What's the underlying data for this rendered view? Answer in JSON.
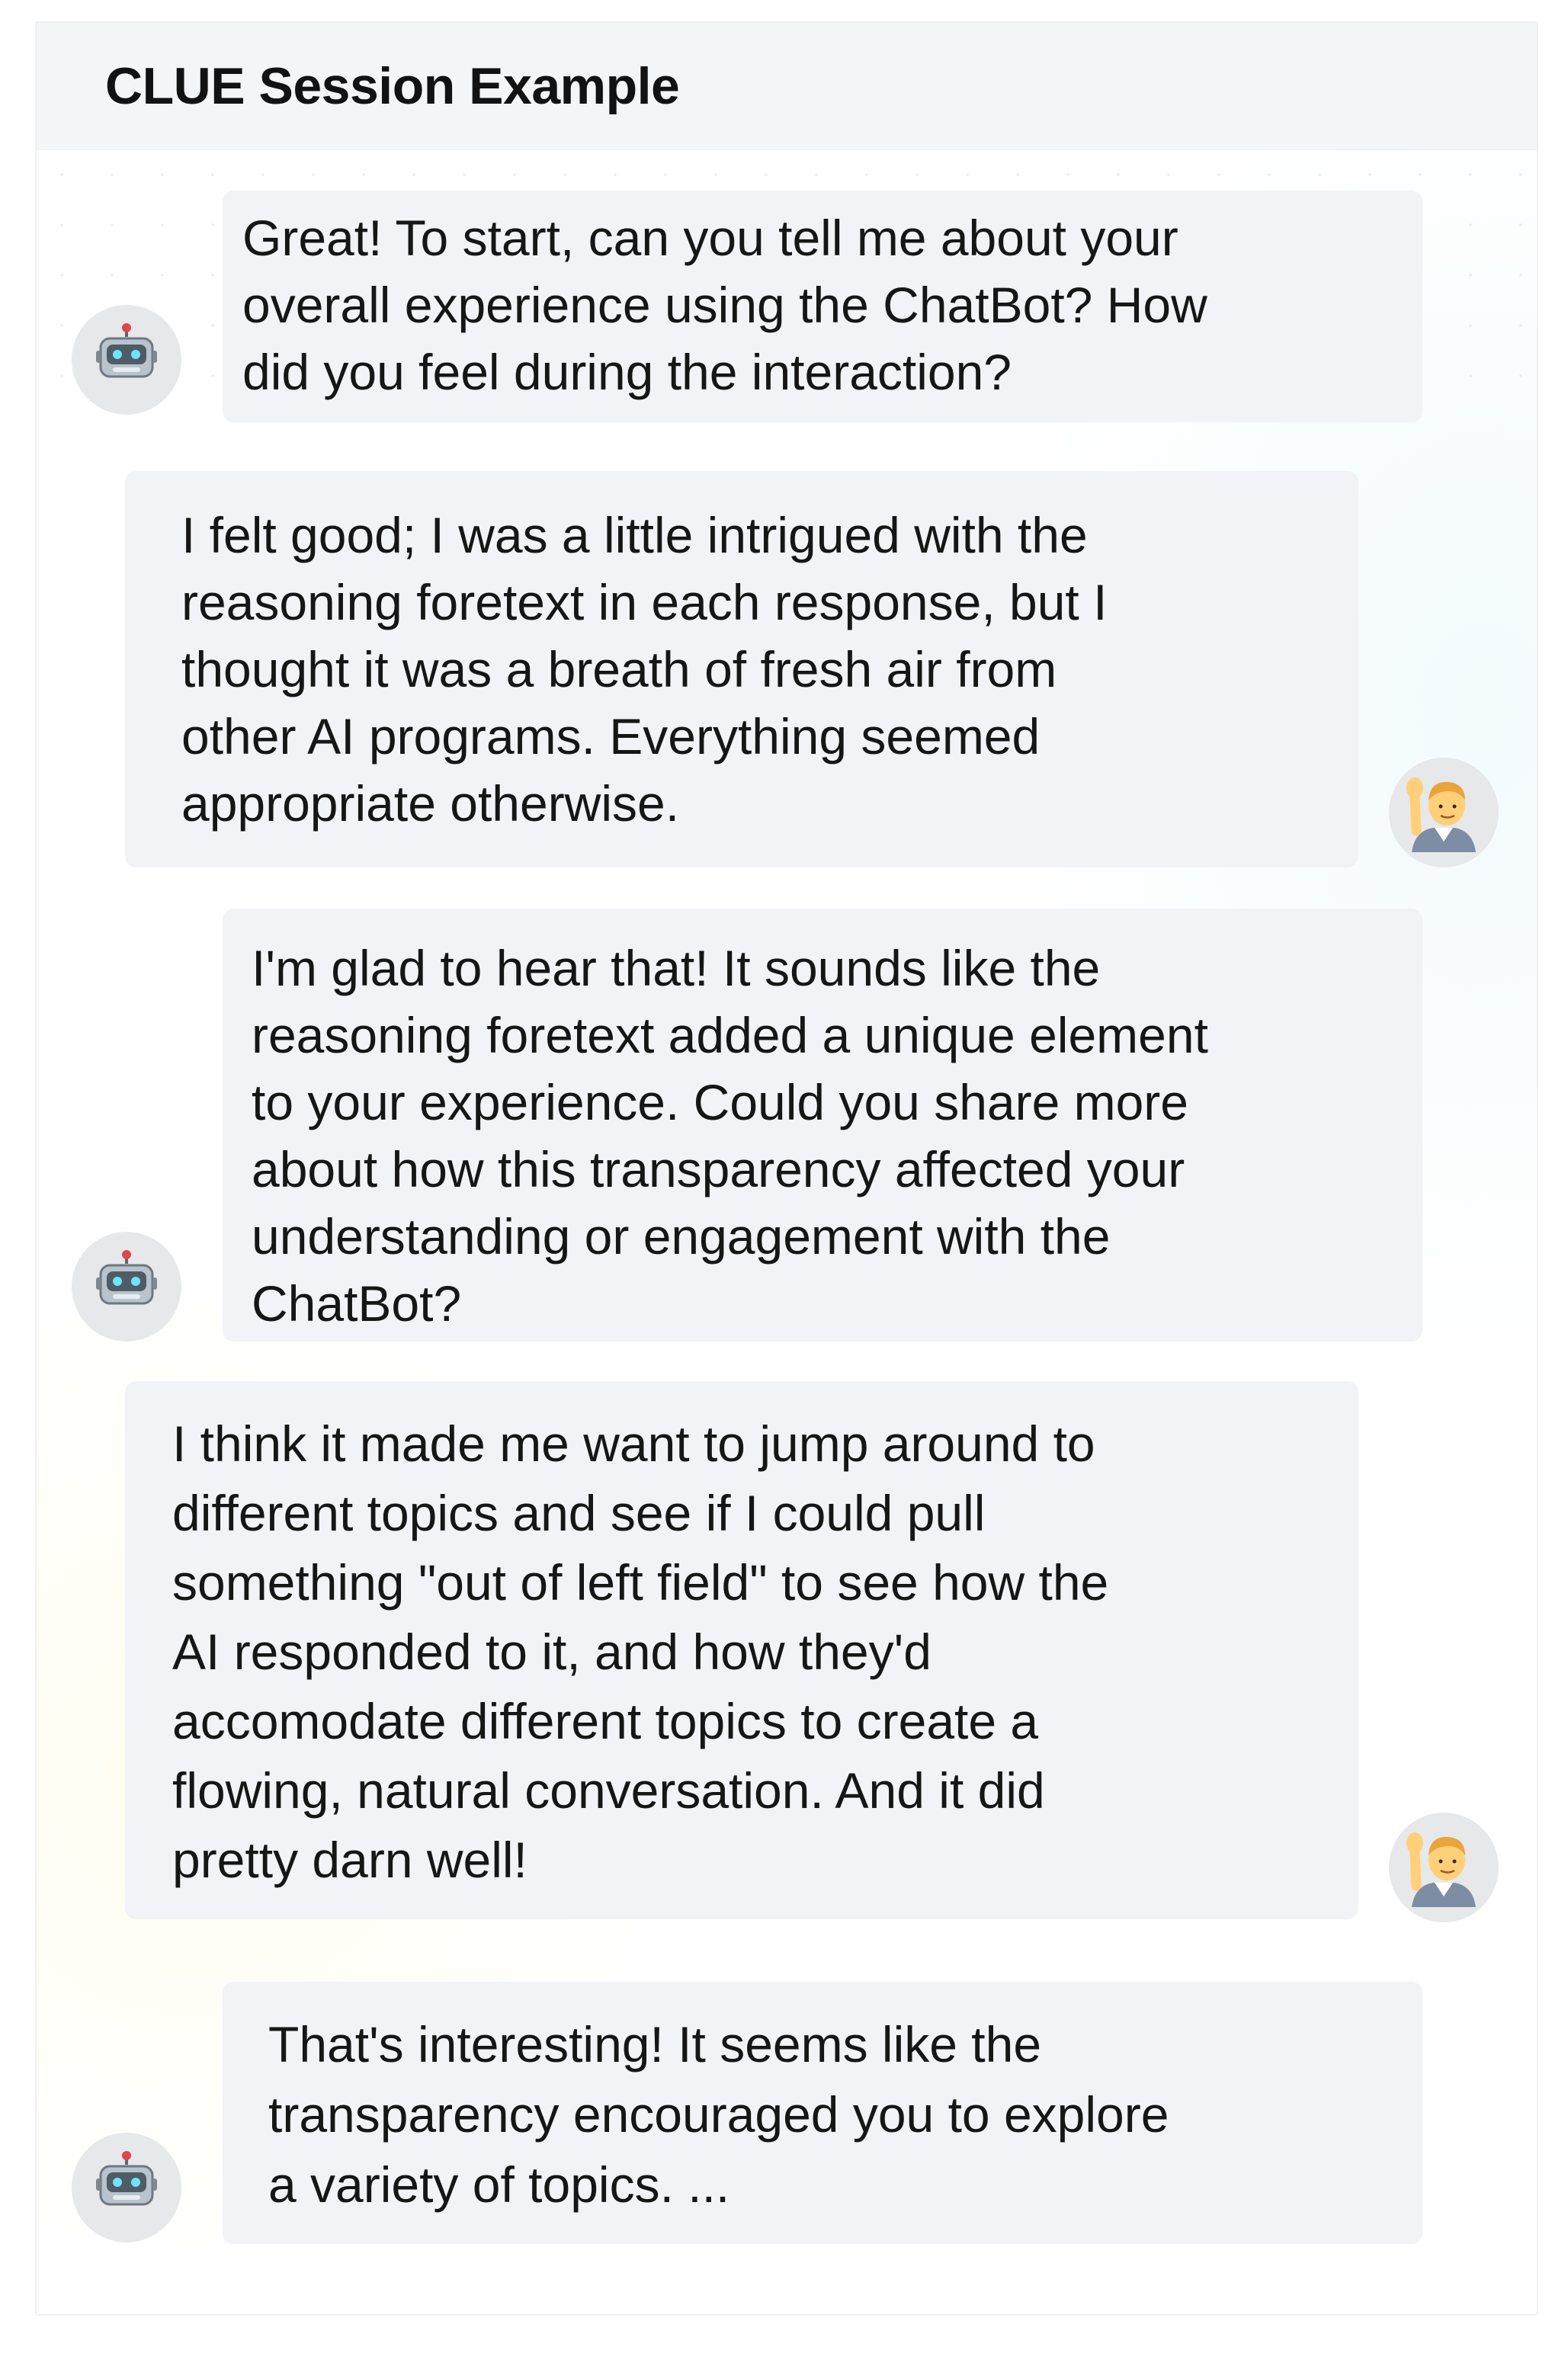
{
  "panel": {
    "title": "CLUE Session Example"
  },
  "messages": [
    {
      "role": "bot",
      "avatar_icon": "robot-icon",
      "lines": [
        "Great! To start, can you tell me about your",
        "overall experience using the ChatBot? How",
        "did you feel during the interaction?"
      ]
    },
    {
      "role": "user",
      "avatar_icon": "person-raising-hand-icon",
      "lines": [
        "I felt good; I was a little intrigued with the",
        "reasoning foretext in each response, but I",
        "thought it was a breath of fresh air from",
        "other AI programs. Everything seemed",
        "appropriate otherwise."
      ]
    },
    {
      "role": "bot",
      "avatar_icon": "robot-icon",
      "lines": [
        "I'm glad to hear that! It sounds like the",
        "reasoning foretext added a unique element",
        "to your experience. Could you share more",
        "about how this transparency affected your",
        "understanding or engagement with the",
        "ChatBot?"
      ]
    },
    {
      "role": "user",
      "avatar_icon": "person-raising-hand-icon",
      "lines": [
        "I think it made me want to jump around to",
        "different topics and see if I could pull",
        "something \"out of left field\" to see how the",
        "AI responded to it, and how they'd",
        "accomodate different topics to create a",
        "flowing, natural conversation. And it did",
        "pretty darn well!"
      ]
    },
    {
      "role": "bot",
      "avatar_icon": "robot-icon",
      "lines": [
        "That's interesting! It seems like the",
        "transparency encouraged you to explore",
        "a variety of topics. ..."
      ]
    }
  ],
  "colors": {
    "header_bg": "#f4f5f7",
    "bubble_bg": "#f1f3f6",
    "avatar_bg": "#e7e8ea",
    "text": "#161616"
  }
}
